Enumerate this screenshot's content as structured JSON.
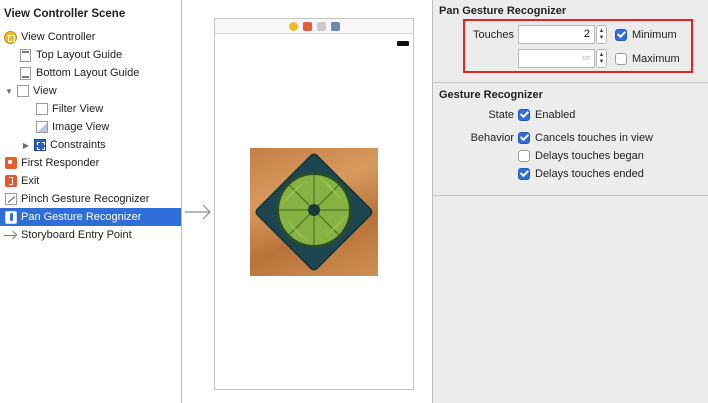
{
  "outline": {
    "scene_title": "View Controller Scene",
    "items": [
      {
        "label": "View Controller",
        "icon": "view-controller-icon"
      },
      {
        "label": "Top Layout Guide",
        "icon": "layout-guide-icon"
      },
      {
        "label": "Bottom Layout Guide",
        "icon": "layout-guide-icon"
      },
      {
        "label": "View",
        "icon": "view-icon"
      },
      {
        "label": "Filter View",
        "icon": "view-icon"
      },
      {
        "label": "Image View",
        "icon": "image-view-icon"
      },
      {
        "label": "Constraints",
        "icon": "constraints-icon"
      },
      {
        "label": "First Responder",
        "icon": "first-responder-icon"
      },
      {
        "label": "Exit",
        "icon": "exit-icon"
      },
      {
        "label": "Pinch Gesture Recognizer",
        "icon": "pinch-gesture-icon"
      },
      {
        "label": "Pan Gesture Recognizer",
        "icon": "pan-gesture-icon",
        "selected": true
      },
      {
        "label": "Storyboard Entry Point",
        "icon": "entry-point-arrow-icon"
      }
    ]
  },
  "inspector": {
    "pan": {
      "title": "Pan Gesture Recognizer",
      "touches_label": "Touches",
      "minimum_value": "2",
      "maximum_placeholder": "∞",
      "minimum_label": "Minimum",
      "minimum_checked": true,
      "maximum_label": "Maximum",
      "maximum_checked": false
    },
    "gesture": {
      "title": "Gesture Recognizer",
      "state_label": "State",
      "enabled_label": "Enabled",
      "enabled_checked": true,
      "behavior_label": "Behavior",
      "cancels_label": "Cancels touches in view",
      "cancels_checked": true,
      "delays_began_label": "Delays touches began",
      "delays_began_checked": false,
      "delays_ended_label": "Delays touches ended",
      "delays_ended_checked": true
    }
  },
  "colors": {
    "selection": "#2f6ed8",
    "highlight_box": "#e0231f",
    "checkbox_on": "#2f6ed8"
  }
}
